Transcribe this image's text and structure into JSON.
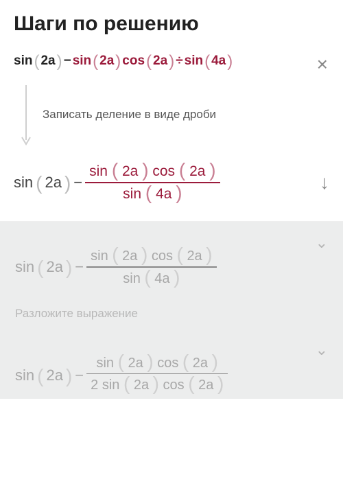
{
  "title": "Шаги по решению",
  "expr1": {
    "t1": "sin",
    "p1o": "(",
    "a1": "2a",
    "p1c": ")",
    "minus": " − ",
    "t2": "sin",
    "p2o": "(",
    "a2": "2a",
    "p2c": ")",
    "t3": "cos",
    "p3o": "(",
    "a3": "2a",
    "p3c": ")",
    "div": " ÷ ",
    "t4": "sin",
    "p4o": "(",
    "a4": "4a",
    "p4c": ")"
  },
  "note": "Записать деление в виде дроби",
  "expr2": {
    "t1": "sin",
    "p1o": "(",
    "a1": "2a",
    "p1c": ")",
    "minus": " − ",
    "num": {
      "s": "sin",
      "po": "(",
      "a1": "2a",
      "pc": ")",
      "c": "cos",
      "po2": "(",
      "a2": "2a",
      "pc2": ")"
    },
    "den": {
      "s": "sin",
      "po": "(",
      "a": "4a",
      "pc": ")"
    }
  },
  "gray1": {
    "t1": "sin",
    "p1o": "(",
    "a1": "2a",
    "p1c": ")",
    "minus": " − ",
    "num": {
      "s": "sin",
      "po": "(",
      "a1": "2a",
      "pc": ")",
      "c": "cos",
      "po2": "(",
      "a2": "2a",
      "pc2": ")"
    },
    "den": {
      "s": "sin",
      "po": "(",
      "a": "4a",
      "pc": ")"
    }
  },
  "sublabel": "Разложите выражение",
  "gray2": {
    "t1": "sin",
    "p1o": "(",
    "a1": "2a",
    "p1c": ")",
    "minus": " − ",
    "num": {
      "s": "sin",
      "po": "(",
      "a1": "2a",
      "pc": ")",
      "c": "cos",
      "po2": "(",
      "a2": "2a",
      "pc2": ")"
    },
    "den": {
      "two": "2",
      "s": "sin",
      "po": "(",
      "a": "2a",
      "pc": ")",
      "c": "cos",
      "po2": "(",
      "a2": "2a",
      "pc2": ")"
    }
  },
  "close": "×",
  "down": "↓",
  "chev": "⌄"
}
